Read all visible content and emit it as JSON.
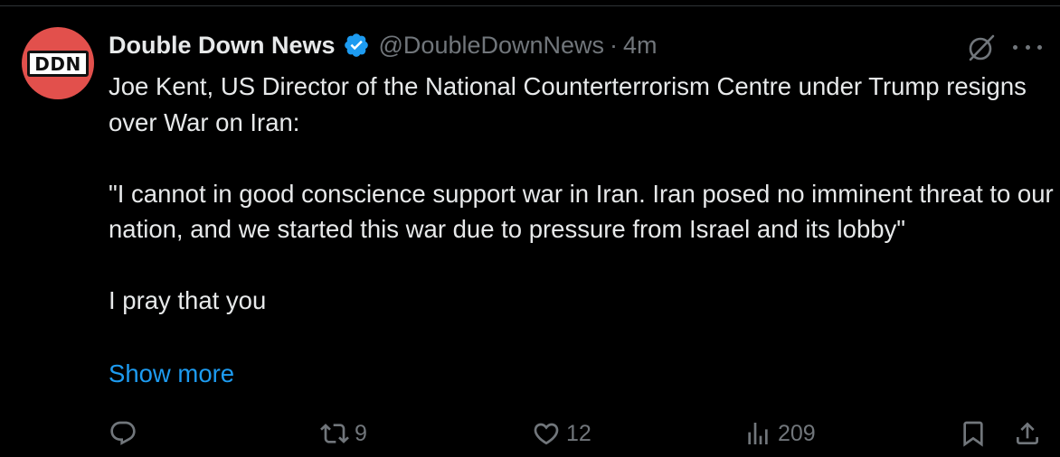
{
  "post": {
    "avatar_text": "DDN",
    "author_name": "Double Down News",
    "handle": "@DoubleDownNews",
    "separator": "·",
    "time": "4m",
    "paragraphs": [
      "Joe Kent, US Director of the National Counterterrorism Centre under Trump resigns over War on Iran:",
      "\"I cannot in good conscience support war in Iran. Iran posed no imminent threat to our nation, and we started this war due to pressure from Israel and its lobby\"",
      "I pray that you"
    ],
    "show_more": "Show more"
  },
  "actions": {
    "replies": "",
    "reposts": "9",
    "likes": "12",
    "views": "209"
  },
  "icons": {
    "verified": "verified-badge-icon",
    "grok": "grok-icon",
    "more": "more-icon",
    "reply": "reply-icon",
    "repost": "repost-icon",
    "like": "heart-icon",
    "views": "views-icon",
    "bookmark": "bookmark-icon",
    "share": "share-icon"
  },
  "colors": {
    "background": "#000000",
    "text": "#e7e9ea",
    "muted": "#71767b",
    "link": "#1d9bf0",
    "verified": "#1d9bf0",
    "avatar": "#e2504c"
  }
}
